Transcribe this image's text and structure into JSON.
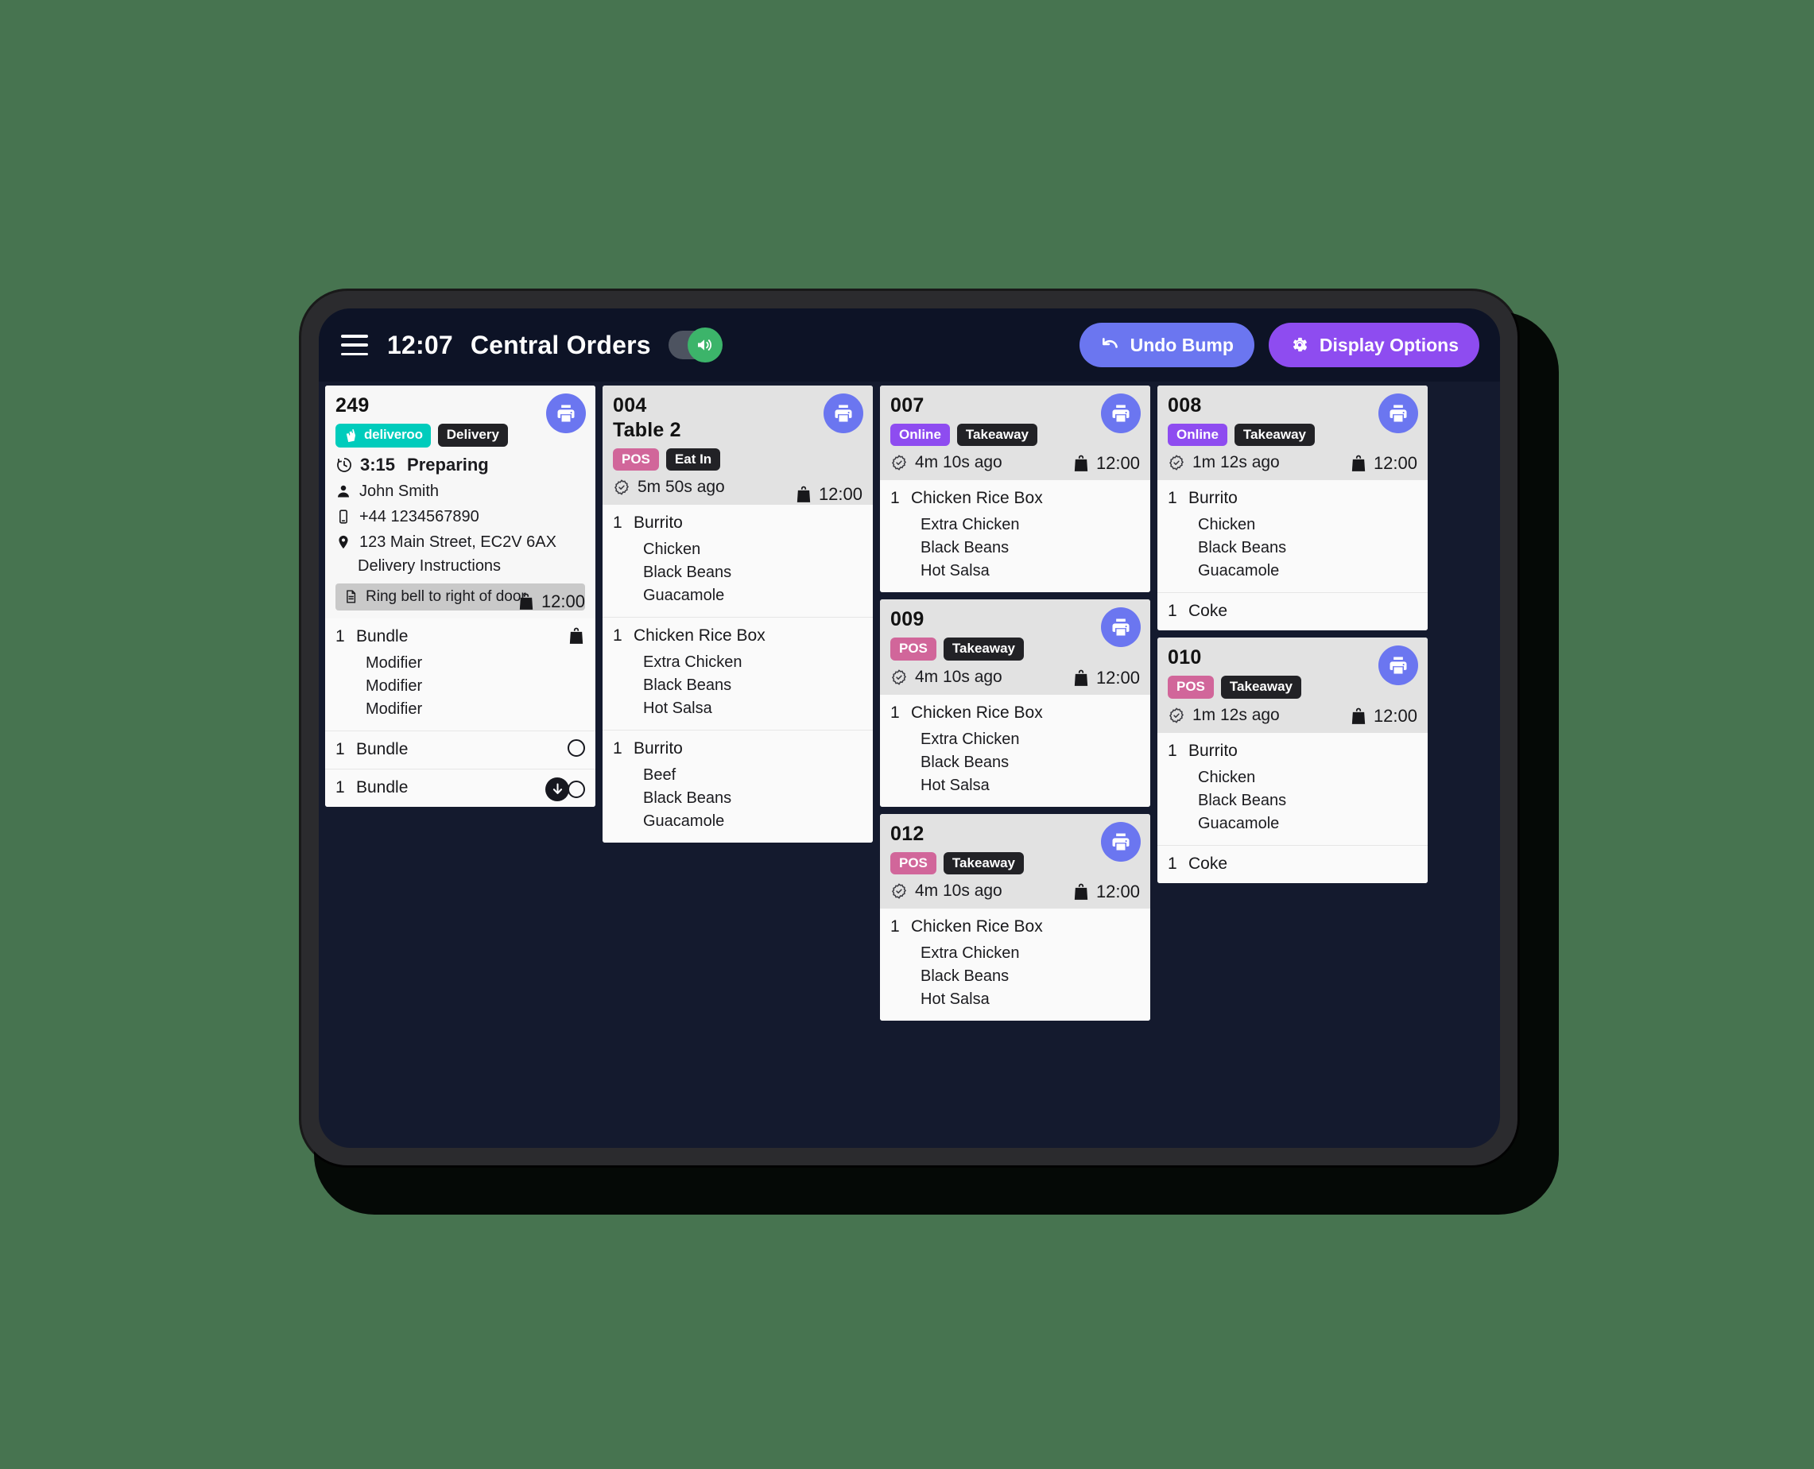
{
  "header": {
    "clock": "12:07",
    "title": "Central Orders",
    "sound_toggle": "on",
    "undo_label": "Undo Bump",
    "display_label": "Display Options"
  },
  "colors": {
    "accent_blue": "#6b76f0",
    "accent_purple": "#8e4cf0",
    "deliveroo_teal": "#00ccbc",
    "pos_pink": "#d1669a",
    "dark_badge": "#222226",
    "screen_bg": "#141a2e",
    "topbar_bg": "#0d1326",
    "page_bg": "#477450",
    "toggle_green": "#3cb46a"
  },
  "columns": [
    {
      "cards": [
        {
          "order_no": "249",
          "table": null,
          "white_head": true,
          "badges": [
            {
              "text": "deliveroo",
              "kind": "deliveroo"
            },
            {
              "text": "Delivery",
              "kind": "dark"
            }
          ],
          "prep_time": "12:00",
          "timer": "3:15",
          "status": "Preparing",
          "customer": "John Smith",
          "phone": "+44 1234567890",
          "address": "123 Main Street, EC2V 6AX",
          "instructions_label": "Delivery Instructions",
          "note": "Ring bell to right of door",
          "items": [
            {
              "qty": "1",
              "name": "Bundle",
              "mods": [
                "Modifier",
                "Modifier",
                "Modifier"
              ],
              "right": "bag"
            },
            {
              "qty": "1",
              "name": "Bundle",
              "mods": [],
              "right": "circle"
            },
            {
              "qty": "1",
              "name": "Bundle",
              "mods": [],
              "right": "arrow-circle"
            }
          ]
        }
      ]
    },
    {
      "cards": [
        {
          "order_no": "004",
          "table": "Table 2",
          "white_head": false,
          "badges": [
            {
              "text": "POS",
              "kind": "pos"
            },
            {
              "text": "Eat In",
              "kind": "dark"
            }
          ],
          "prep_time": "12:00",
          "elapsed": "5m 50s ago",
          "items": [
            {
              "qty": "1",
              "name": "Burrito",
              "mods": [
                "Chicken",
                "Black Beans",
                "Guacamole"
              ]
            },
            {
              "qty": "1",
              "name": "Chicken Rice Box",
              "mods": [
                "Extra Chicken",
                "Black Beans",
                "Hot Salsa"
              ]
            },
            {
              "qty": "1",
              "name": "Burrito",
              "mods": [
                "Beef",
                "Black Beans",
                "Guacamole"
              ]
            }
          ]
        }
      ]
    },
    {
      "cards": [
        {
          "order_no": "007",
          "table": null,
          "white_head": false,
          "badges": [
            {
              "text": "Online",
              "kind": "online"
            },
            {
              "text": "Takeaway",
              "kind": "dark"
            }
          ],
          "prep_time": "12:00",
          "elapsed": "4m 10s ago",
          "items": [
            {
              "qty": "1",
              "name": "Chicken Rice Box",
              "mods": [
                "Extra Chicken",
                "Black Beans",
                "Hot Salsa"
              ]
            }
          ]
        },
        {
          "order_no": "009",
          "table": null,
          "white_head": false,
          "badges": [
            {
              "text": "POS",
              "kind": "pos"
            },
            {
              "text": "Takeaway",
              "kind": "dark"
            }
          ],
          "prep_time": "12:00",
          "elapsed": "4m 10s ago",
          "items": [
            {
              "qty": "1",
              "name": "Chicken Rice Box",
              "mods": [
                "Extra Chicken",
                "Black Beans",
                "Hot Salsa"
              ]
            }
          ]
        },
        {
          "order_no": "012",
          "table": null,
          "white_head": false,
          "badges": [
            {
              "text": "POS",
              "kind": "pos"
            },
            {
              "text": "Takeaway",
              "kind": "dark"
            }
          ],
          "prep_time": "12:00",
          "elapsed": "4m 10s ago",
          "items": [
            {
              "qty": "1",
              "name": "Chicken Rice Box",
              "mods": [
                "Extra Chicken",
                "Black Beans",
                "Hot Salsa"
              ]
            }
          ]
        }
      ]
    },
    {
      "cards": [
        {
          "order_no": "008",
          "table": null,
          "white_head": false,
          "badges": [
            {
              "text": "Online",
              "kind": "online"
            },
            {
              "text": "Takeaway",
              "kind": "dark"
            }
          ],
          "prep_time": "12:00",
          "elapsed": "1m 12s ago",
          "items": [
            {
              "qty": "1",
              "name": "Burrito",
              "mods": [
                "Chicken",
                "Black Beans",
                "Guacamole"
              ]
            },
            {
              "qty": "1",
              "name": "Coke",
              "mods": []
            }
          ]
        },
        {
          "order_no": "010",
          "table": null,
          "white_head": false,
          "badges": [
            {
              "text": "POS",
              "kind": "pos"
            },
            {
              "text": "Takeaway",
              "kind": "dark"
            }
          ],
          "prep_time": "12:00",
          "elapsed": "1m 12s ago",
          "items": [
            {
              "qty": "1",
              "name": "Burrito",
              "mods": [
                "Chicken",
                "Black Beans",
                "Guacamole"
              ]
            },
            {
              "qty": "1",
              "name": "Coke",
              "mods": []
            }
          ]
        }
      ]
    }
  ]
}
